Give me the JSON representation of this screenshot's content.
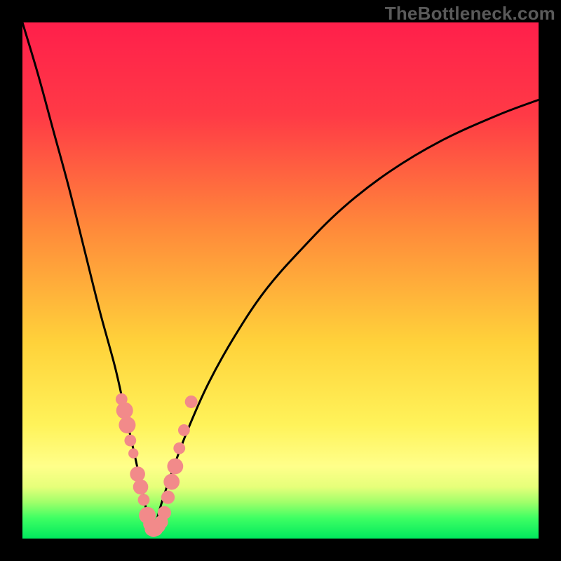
{
  "watermark": {
    "text": "TheBottleneck.com"
  },
  "colors": {
    "gradient_stops": [
      {
        "pct": 0,
        "color": "#ff1f4b"
      },
      {
        "pct": 18,
        "color": "#ff3a46"
      },
      {
        "pct": 40,
        "color": "#ff8a3a"
      },
      {
        "pct": 62,
        "color": "#ffd23a"
      },
      {
        "pct": 78,
        "color": "#fff35a"
      },
      {
        "pct": 86,
        "color": "#ffff8a"
      },
      {
        "pct": 90,
        "color": "#e6ff7a"
      },
      {
        "pct": 93,
        "color": "#9fff6a"
      },
      {
        "pct": 96,
        "color": "#3fff63"
      },
      {
        "pct": 100,
        "color": "#00e85e"
      }
    ],
    "curve": "#000000",
    "marker_fill": "#f28a8a",
    "marker_stroke": "#ffffff",
    "frame_bg": "#000000"
  },
  "chart_data": {
    "type": "line",
    "title": "",
    "xlabel": "",
    "ylabel": "",
    "xlim": [
      0,
      100
    ],
    "ylim": [
      0,
      100
    ],
    "note": "Bottleneck-style V curve. x is component balance position (arbitrary %), y is bottleneck severity (0 = none, 100 = severe). Marker points are highlighted configurations clustered near the minimum.",
    "series": [
      {
        "name": "bottleneck-curve",
        "x": [
          0,
          3,
          6,
          9,
          12,
          15,
          18,
          20,
          22,
          23.5,
          24.5,
          25,
          25.5,
          26,
          27,
          29,
          32,
          36,
          41,
          47,
          54,
          62,
          71,
          81,
          92,
          100
        ],
        "y": [
          100,
          90,
          79,
          68,
          56,
          44,
          33,
          24,
          15,
          8,
          3,
          1.5,
          2,
          3.5,
          7,
          13,
          21,
          30,
          39,
          48,
          56,
          64,
          71,
          77,
          82,
          85
        ]
      }
    ],
    "markers": [
      {
        "x": 19.2,
        "y": 27.0,
        "r": 1.4
      },
      {
        "x": 19.8,
        "y": 24.8,
        "r": 2.0
      },
      {
        "x": 20.3,
        "y": 22.0,
        "r": 2.0
      },
      {
        "x": 20.9,
        "y": 19.0,
        "r": 1.4
      },
      {
        "x": 21.5,
        "y": 16.5,
        "r": 1.2
      },
      {
        "x": 22.3,
        "y": 12.5,
        "r": 1.8
      },
      {
        "x": 22.9,
        "y": 10.0,
        "r": 1.8
      },
      {
        "x": 23.5,
        "y": 7.5,
        "r": 1.4
      },
      {
        "x": 24.2,
        "y": 4.5,
        "r": 2.0
      },
      {
        "x": 24.7,
        "y": 2.8,
        "r": 1.6
      },
      {
        "x": 25.0,
        "y": 1.8,
        "r": 1.6
      },
      {
        "x": 25.4,
        "y": 1.6,
        "r": 1.6
      },
      {
        "x": 25.9,
        "y": 1.8,
        "r": 1.6
      },
      {
        "x": 26.4,
        "y": 2.4,
        "r": 1.6
      },
      {
        "x": 26.9,
        "y": 3.2,
        "r": 1.6
      },
      {
        "x": 27.5,
        "y": 5.0,
        "r": 1.6
      },
      {
        "x": 28.2,
        "y": 8.0,
        "r": 1.6
      },
      {
        "x": 28.9,
        "y": 11.0,
        "r": 1.9
      },
      {
        "x": 29.6,
        "y": 14.0,
        "r": 1.9
      },
      {
        "x": 30.4,
        "y": 17.5,
        "r": 1.4
      },
      {
        "x": 31.3,
        "y": 21.0,
        "r": 1.4
      },
      {
        "x": 32.7,
        "y": 26.5,
        "r": 1.5
      }
    ]
  }
}
